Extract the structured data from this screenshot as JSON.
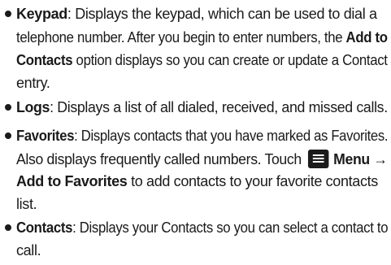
{
  "items": [
    {
      "term": "Keypad",
      "sep": ": ",
      "line1_rest": "Displays the keypad, which can be used to dial a",
      "line2_a": "telephone number. After you begin to enter numbers, the ",
      "line2_bold": "Add to",
      "line3_bold": "Contacts",
      "line3_rest": " option displays so you can create or update a Contact",
      "line4": "entry."
    },
    {
      "term": "Logs",
      "sep": ": ",
      "line1_rest": "Displays a list of all dialed, received, and missed calls."
    },
    {
      "term": "Favorites",
      "sep": ": ",
      "line1_rest": "Displays contacts that you have marked as Favorites.",
      "line2_a": "Also displays frequently called numbers. Touch",
      "menu_icon": "menu-icon",
      "line2_bold": "Menu →",
      "line3_bold": "Add to Favorites",
      "line3_rest": " to add contacts to your favorite contacts",
      "line4": "list."
    },
    {
      "term": "Contacts",
      "sep": ": ",
      "line1_rest": "Displays your Contacts so you can select a contact to",
      "line2": "call."
    }
  ]
}
